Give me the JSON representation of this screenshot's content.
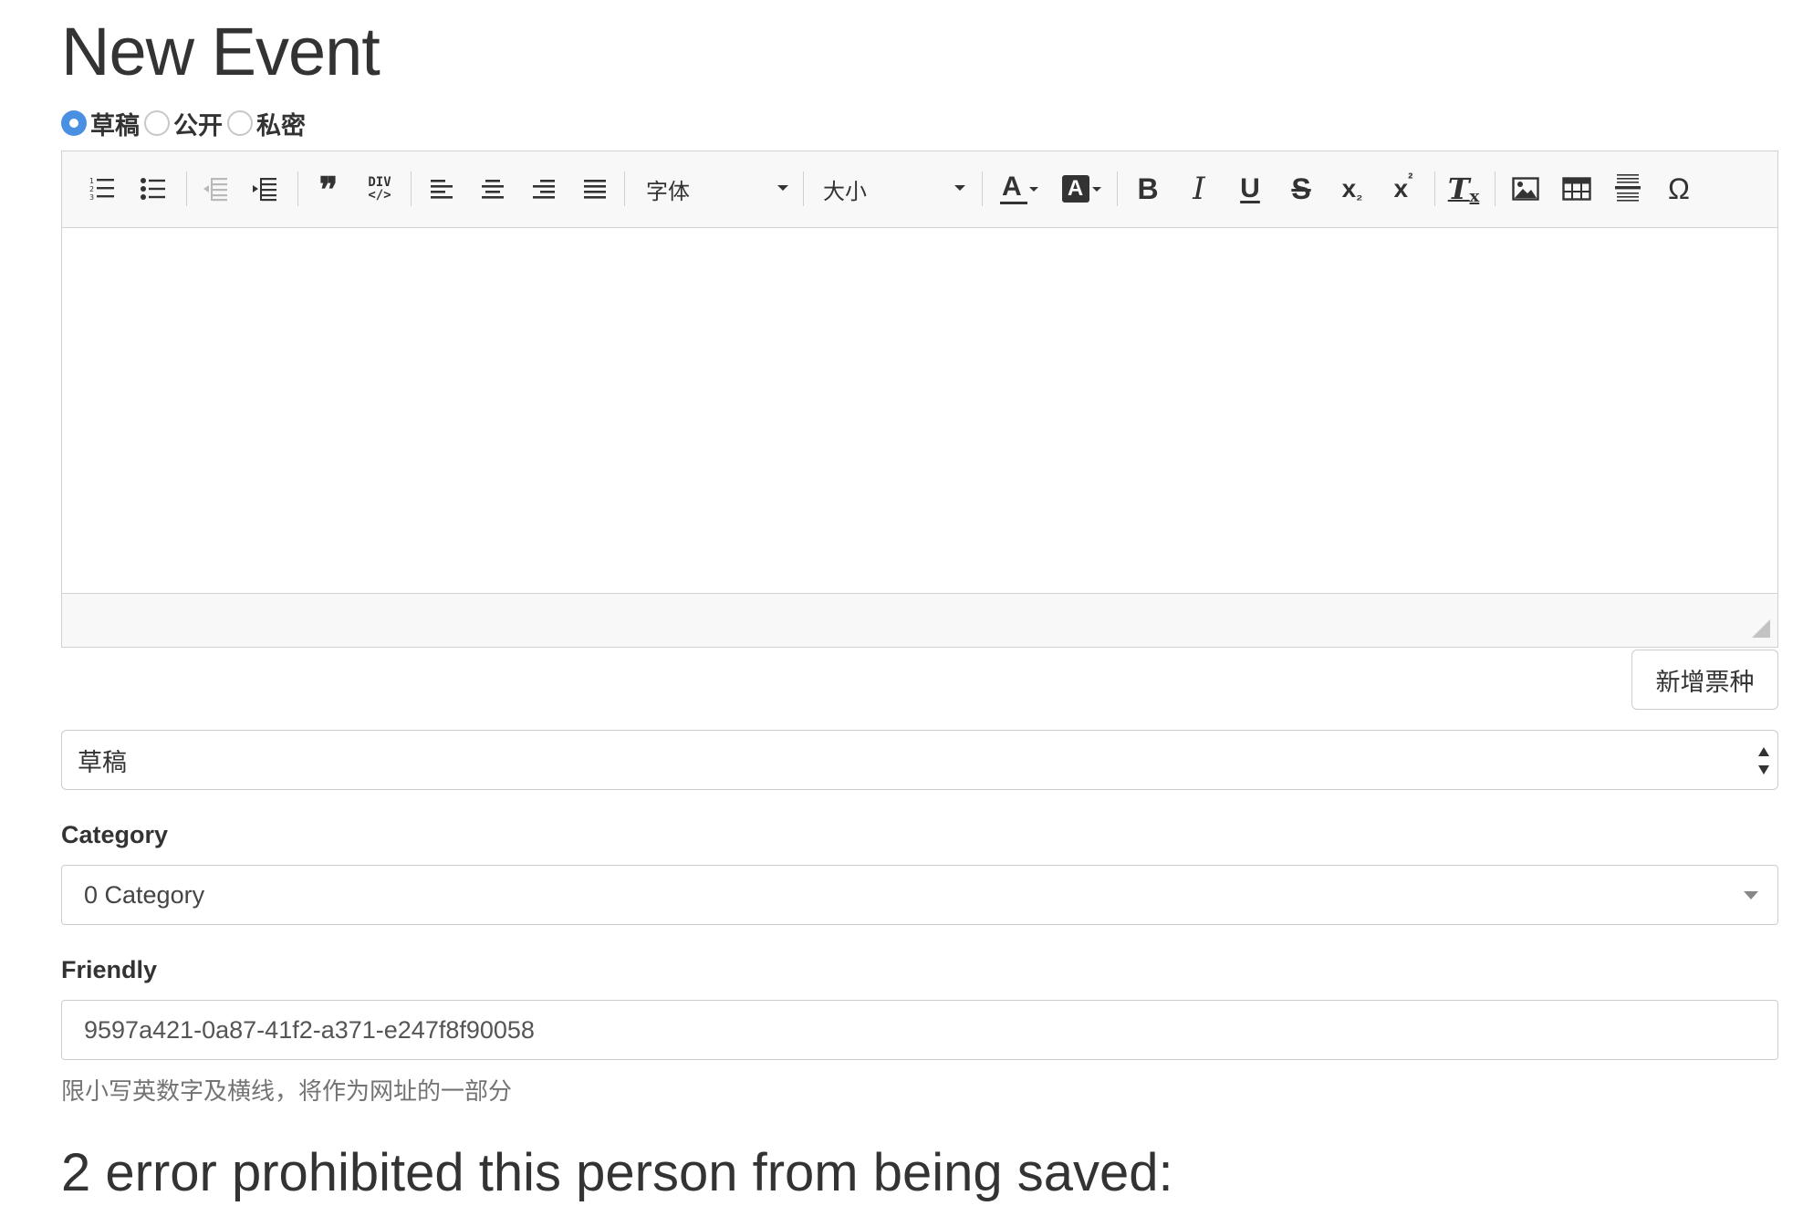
{
  "page": {
    "title": "New Event"
  },
  "status_radios": [
    {
      "label": "草稿",
      "checked": true
    },
    {
      "label": "公开",
      "checked": false
    },
    {
      "label": "私密",
      "checked": false
    }
  ],
  "editor": {
    "toolbar": {
      "font_label": "字体",
      "size_label": "大小",
      "buttons": [
        "numbered-list-icon",
        "bulleted-list-icon",
        "outdent-icon",
        "indent-icon",
        "blockquote-icon",
        "div-container-icon",
        "align-left-icon",
        "align-center-icon",
        "align-right-icon",
        "align-justify-icon",
        "text-color-icon",
        "background-color-icon",
        "bold-icon",
        "italic-icon",
        "underline-icon",
        "strikethrough-icon",
        "subscript-icon",
        "superscript-icon",
        "remove-format-icon",
        "image-icon",
        "table-icon",
        "horizontal-line-icon",
        "special-character-icon"
      ],
      "glyphs": {
        "blockquote": "❞",
        "div_top": "DIV",
        "div_bottom": "</>",
        "text_color": "A",
        "bg_color": "A",
        "bold": "B",
        "italic": "I",
        "underline": "U",
        "strike": "S",
        "subscript": "x",
        "subscript_small": "₂",
        "superscript": "x",
        "superscript_small": "²",
        "remove_format": "T",
        "remove_format_small": "x",
        "special_char": "Ω"
      }
    },
    "content": ""
  },
  "add_ticket_button": {
    "label": "新增票种"
  },
  "status_select": {
    "value": "草稿"
  },
  "category": {
    "label": "Category",
    "value": "0 Category"
  },
  "friendly": {
    "label": "Friendly",
    "value": "9597a421-0a87-41f2-a371-e247f8f90058",
    "help": "限小写英数字及横线，将作为网址的一部分"
  },
  "errors": {
    "heading": "2 error prohibited this person from being saved:"
  },
  "colors": {
    "accent": "#4a90e2",
    "border": "#cccccc",
    "toolbar_bg": "#f8f8f8",
    "help_text": "#737373"
  }
}
